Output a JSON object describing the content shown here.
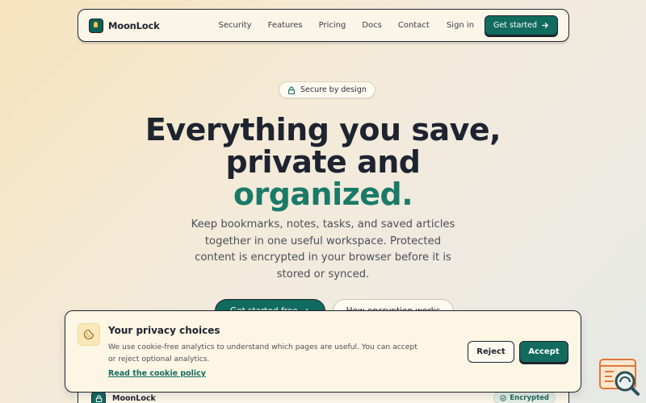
{
  "nav": {
    "brand": "MoonLock",
    "links": [
      "Security",
      "Features",
      "Pricing",
      "Docs",
      "Contact"
    ],
    "sign_in": "Sign in",
    "get_started": "Get started",
    "get_started_icon": "arrow-right-icon"
  },
  "hero": {
    "badge": "Secure by design",
    "badge_icon": "lock-icon",
    "title_line1": "Everything you save,",
    "title_line2": "private and",
    "title_accent": "organized.",
    "subtitle": "Keep bookmarks, notes, tasks, and saved articles together in one useful workspace. Protected content is encrypted in your browser before it is stored or synced.",
    "cta_primary": "Get started free",
    "cta_secondary": "How encryption works"
  },
  "preview": {
    "brand": "MoonLock",
    "badge": "Encrypted"
  },
  "cookie": {
    "title": "Your privacy choices",
    "text": "We use cookie-free analytics to understand which pages are useful. You can accept or reject optional analytics.",
    "link": "Read the cookie policy",
    "reject": "Reject",
    "accept": "Accept",
    "icon": "cookie-icon"
  },
  "colors": {
    "accent": "#126b5f",
    "accent_text": "#1a7a68",
    "ink": "#1e2330",
    "cream": "#fdf6e4"
  }
}
